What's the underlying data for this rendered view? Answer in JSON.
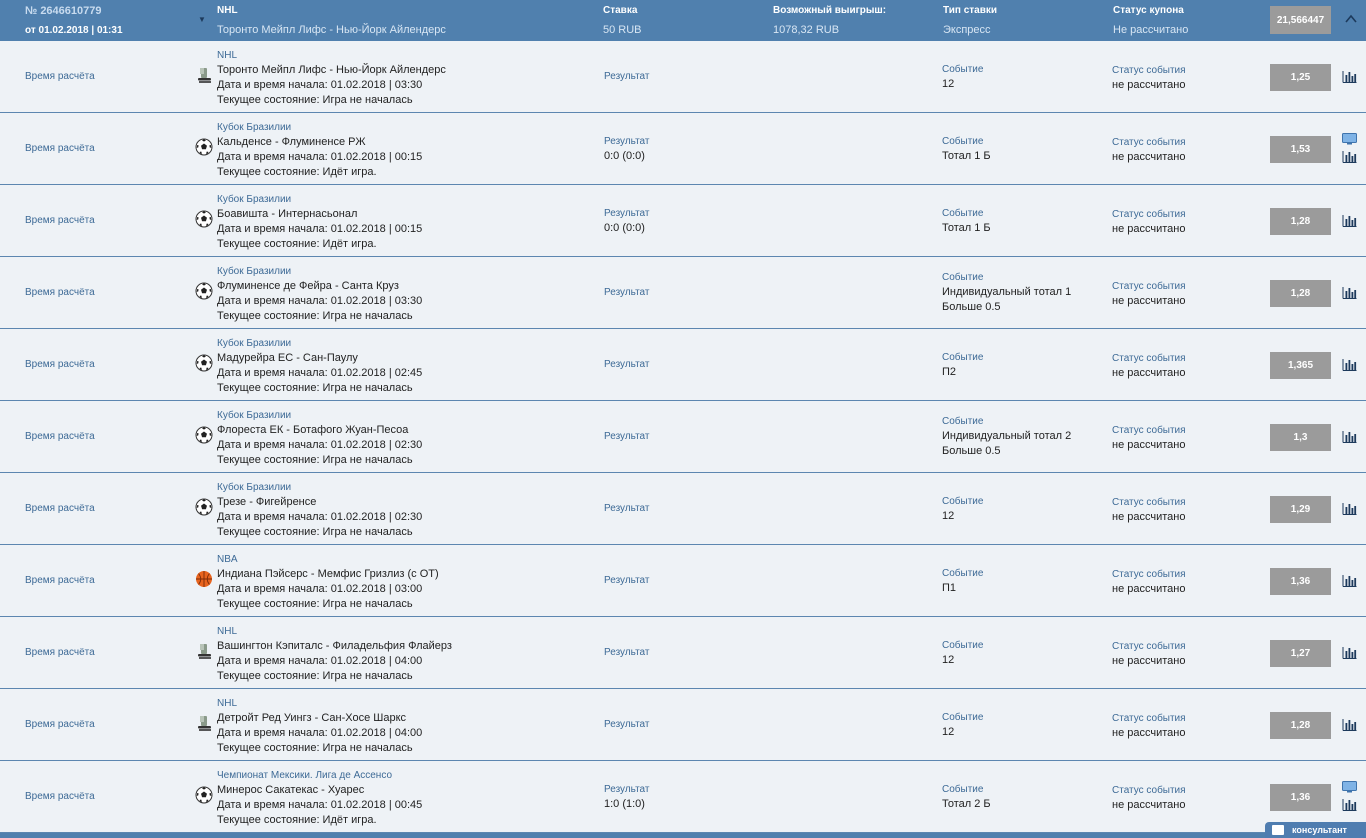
{
  "coupon": {
    "number": "№ 2646610779",
    "date": "от 01.02.2018 | 01:31",
    "league": "NHL",
    "match": "Торонто Мейпл Лифс - Нью-Йорк Айлендерс",
    "stake_label": "Ставка",
    "stake_value": "50 RUB",
    "win_label": "Возможный выигрыш:",
    "win_value": "1078,32 RUB",
    "type_label": "Тип ставки",
    "type_value": "Экспресс",
    "status_label": "Статус купона",
    "status_value": "Не рассчитано",
    "total_coef": "21,566447"
  },
  "labels": {
    "calc_time": "Время расчёта",
    "result": "Результат",
    "event": "Событие",
    "event_status": "Статус события",
    "consultant": "консультант"
  },
  "colors": {
    "header_bg": "#5080ae",
    "row_bg": "#eef2f6",
    "label_blue": "#3d6a96",
    "coef_bg": "#9b9b9b"
  },
  "rows": [
    {
      "sport": "hockey-icon",
      "league": "NHL",
      "match": "Торонто Мейпл Лифс - Нью-Йорк Айлендерс",
      "start": "Дата и время начала: 01.02.2018 | 03:30",
      "state": "Текущее состояние: Игра не началась",
      "result": "",
      "event_lines": [
        "12"
      ],
      "status": "не рассчитано",
      "coef": "1,25",
      "tv": false
    },
    {
      "sport": "soccer-ball-icon",
      "league": "Кубок Бразилии",
      "match": "Кальденсе - Флуминенсе РЖ",
      "start": "Дата и время начала: 01.02.2018 | 00:15",
      "state": "Текущее состояние: Идёт игра.",
      "result": "0:0 (0:0)",
      "event_lines": [
        "Тотал 1 Б"
      ],
      "status": "не рассчитано",
      "coef": "1,53",
      "tv": true
    },
    {
      "sport": "soccer-ball-icon",
      "league": "Кубок Бразилии",
      "match": "Боавишта - Интернасьонал",
      "start": "Дата и время начала: 01.02.2018 | 00:15",
      "state": "Текущее состояние: Идёт игра.",
      "result": "0:0 (0:0)",
      "event_lines": [
        "Тотал 1 Б"
      ],
      "status": "не рассчитано",
      "coef": "1,28",
      "tv": false
    },
    {
      "sport": "soccer-ball-icon",
      "league": "Кубок Бразилии",
      "match": "Флуминенсе де Фейра - Санта Круз",
      "start": "Дата и время начала: 01.02.2018 | 03:30",
      "state": "Текущее состояние: Игра не началась",
      "result": "",
      "event_lines": [
        "Индивидуальный тотал 1",
        "Больше 0.5"
      ],
      "status": "не рассчитано",
      "coef": "1,28",
      "tv": false
    },
    {
      "sport": "soccer-ball-icon",
      "league": "Кубок Бразилии",
      "match": "Мадурейра ЕС - Сан-Паулу",
      "start": "Дата и время начала: 01.02.2018 | 02:45",
      "state": "Текущее состояние: Игра не началась",
      "result": "",
      "event_lines": [
        "П2"
      ],
      "status": "не рассчитано",
      "coef": "1,365",
      "tv": false
    },
    {
      "sport": "soccer-ball-icon",
      "league": "Кубок Бразилии",
      "match": "Флореста ЕК - Ботафого Жуан-Песоа",
      "start": "Дата и время начала: 01.02.2018 | 02:30",
      "state": "Текущее состояние: Игра не началась",
      "result": "",
      "event_lines": [
        "Индивидуальный тотал 2",
        "Больше 0.5"
      ],
      "status": "не рассчитано",
      "coef": "1,3",
      "tv": false
    },
    {
      "sport": "soccer-ball-icon",
      "league": "Кубок Бразилии",
      "match": "Трезе - Фигейренсе",
      "start": "Дата и время начала: 01.02.2018 | 02:30",
      "state": "Текущее состояние: Игра не началась",
      "result": "",
      "event_lines": [
        "12"
      ],
      "status": "не рассчитано",
      "coef": "1,29",
      "tv": false
    },
    {
      "sport": "basketball-icon",
      "league": "NBA",
      "match": "Индиана Пэйсерс - Мемфис Гризлиз (с ОТ)",
      "start": "Дата и время начала: 01.02.2018 | 03:00",
      "state": "Текущее состояние: Игра не началась",
      "result": "",
      "event_lines": [
        "П1"
      ],
      "status": "не рассчитано",
      "coef": "1,36",
      "tv": false
    },
    {
      "sport": "hockey-icon",
      "league": "NHL",
      "match": "Вашингтон Кэпиталс - Филадельфия Флайерз",
      "start": "Дата и время начала: 01.02.2018 | 04:00",
      "state": "Текущее состояние: Игра не началась",
      "result": "",
      "event_lines": [
        "12"
      ],
      "status": "не рассчитано",
      "coef": "1,27",
      "tv": false
    },
    {
      "sport": "hockey-icon",
      "league": "NHL",
      "match": "Детройт Ред Уингз - Сан-Хосе Шаркс",
      "start": "Дата и время начала: 01.02.2018 | 04:00",
      "state": "Текущее состояние: Игра не началась",
      "result": "",
      "event_lines": [
        "12"
      ],
      "status": "не рассчитано",
      "coef": "1,28",
      "tv": false
    },
    {
      "sport": "soccer-ball-icon",
      "league": "Чемпионат Мексики. Лига де Ассенсо",
      "match": "Минерос Сакатекас - Хуарес",
      "start": "Дата и время начала: 01.02.2018 | 00:45",
      "state": "Текущее состояние: Идёт игра.",
      "result": "1:0 (1:0)",
      "event_lines": [
        "Тотал 2 Б"
      ],
      "status": "не рассчитано",
      "coef": "1,36",
      "tv": true
    }
  ]
}
